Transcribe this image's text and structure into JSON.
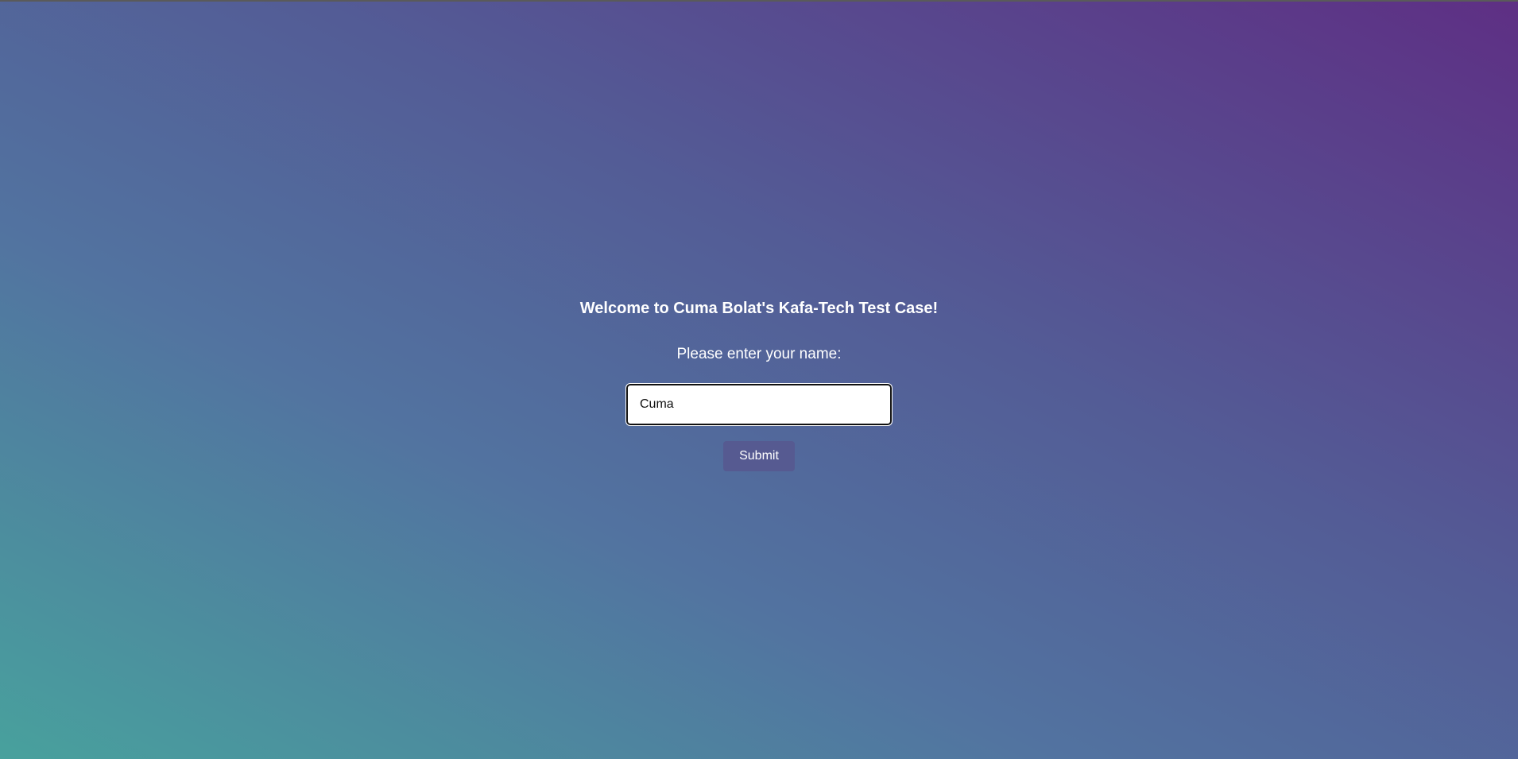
{
  "form": {
    "title": "Welcome to Cuma Bolat's Kafa-Tech Test Case!",
    "prompt": "Please enter your name:",
    "name_value": "Cuma",
    "submit_label": "Submit"
  },
  "colors": {
    "gradient_start": "#48a19d",
    "gradient_end": "#5e2f84",
    "button_bg": "#565a91",
    "text": "#ffffff"
  }
}
